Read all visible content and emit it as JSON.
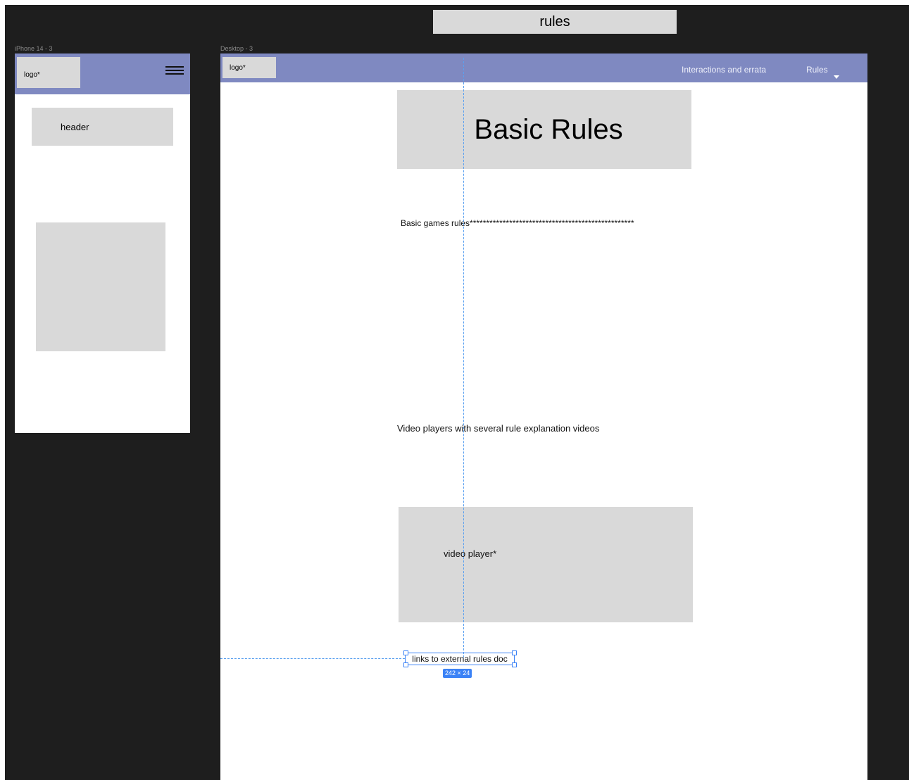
{
  "top_title": "rules",
  "phone": {
    "frame_label": "iPhone 14 - 3",
    "logo": "logo*",
    "menu_icon": "hamburger-icon",
    "header": "header"
  },
  "desktop": {
    "frame_label": "Desktop - 3",
    "logo": "logo*",
    "nav": {
      "interactions": "Interactions and errata",
      "rules": "Rules"
    },
    "hero_title": "Basic Rules",
    "rules_text": "Basic games rules**************************************************",
    "video_text": "Video players with several rule explanation videos",
    "video_player_label": "video player*",
    "links_text": "links to external rules doc",
    "selection_size": "242 × 24"
  },
  "colors": {
    "canvas": "#1e1e1e",
    "navbar": "#7f89c1",
    "placeholder": "#d9d9d9",
    "selection": "#3b82f6"
  }
}
